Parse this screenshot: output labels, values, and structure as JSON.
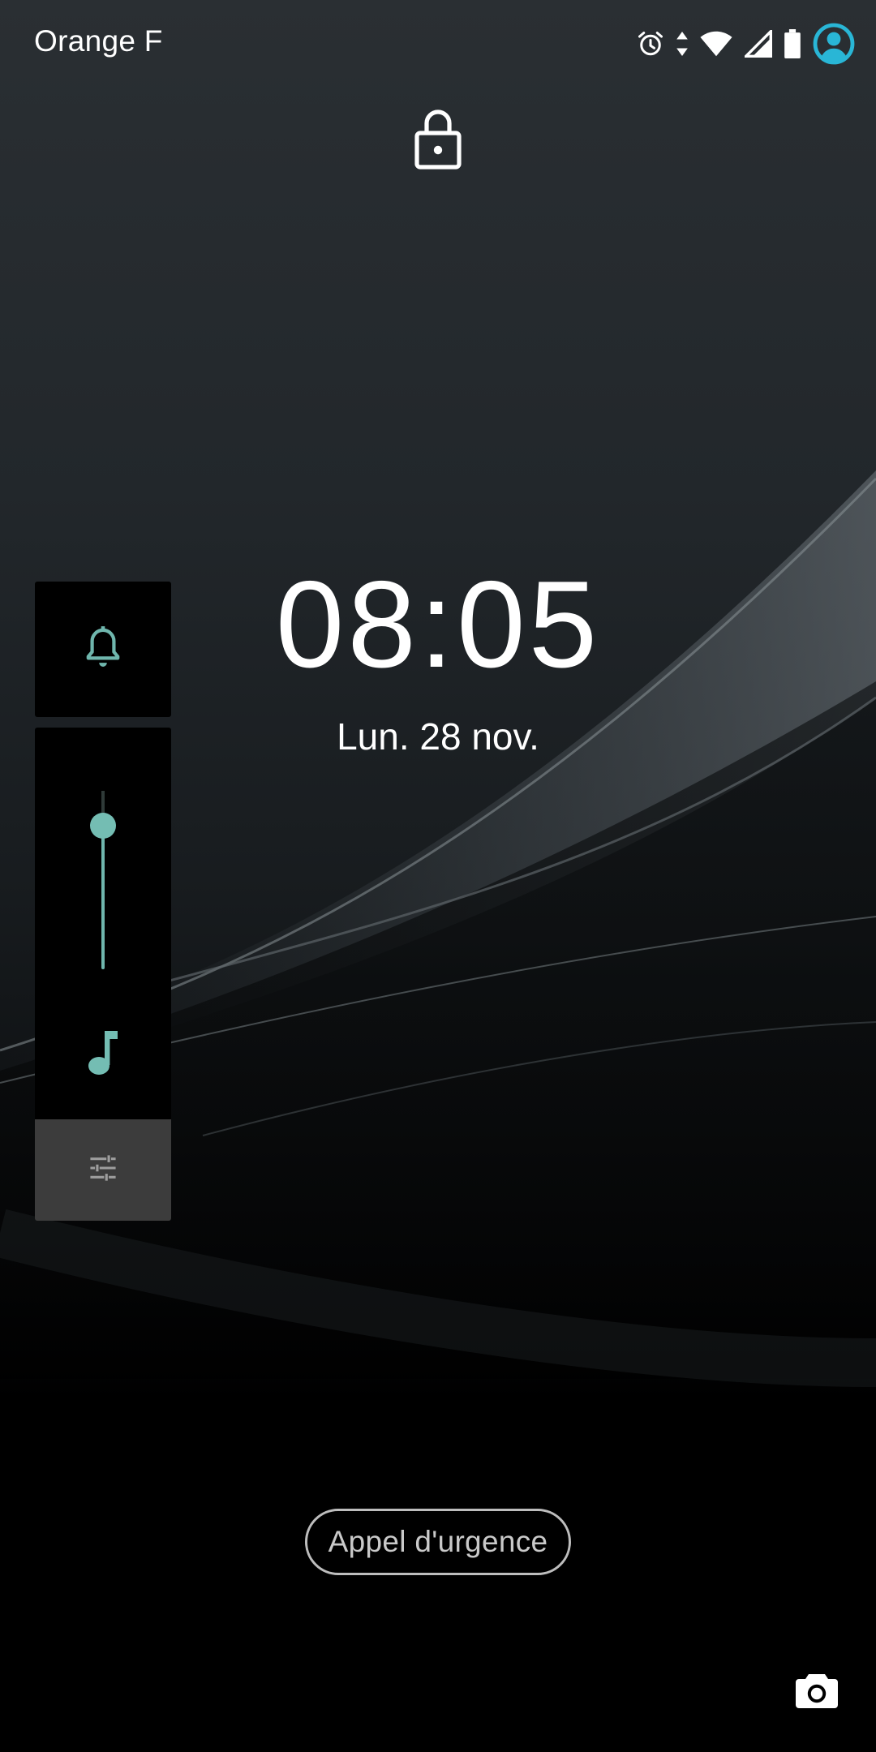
{
  "status_bar": {
    "carrier": "Orange F",
    "icons": [
      "alarm-icon",
      "data-arrows-icon",
      "wifi-icon",
      "cell-signal-icon",
      "battery-icon",
      "user-account-icon"
    ],
    "account_icon_color": "#29b6d6"
  },
  "lockscreen": {
    "lock_icon": "lock-icon",
    "time": "08:05",
    "date": "Lun. 28 nov."
  },
  "volume_panel": {
    "ringer_icon": "bell-icon",
    "media_icon": "music-note-icon",
    "settings_icon": "sliders-icon",
    "media_volume_level": 0.8,
    "accent_color": "#6fb6ad"
  },
  "footer": {
    "emergency_label": "Appel d'urgence",
    "camera_icon": "camera-icon"
  }
}
